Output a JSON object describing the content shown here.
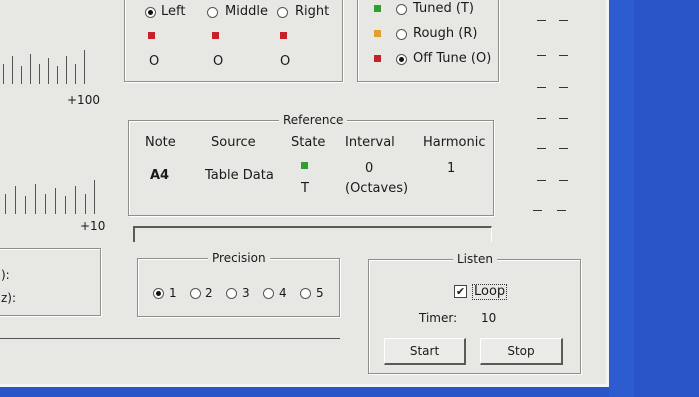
{
  "position_group": {
    "options": [
      {
        "label": "Left",
        "selected": true
      },
      {
        "label": "Middle",
        "selected": false
      },
      {
        "label": "Right",
        "selected": false
      }
    ],
    "values": [
      "O",
      "O",
      "O"
    ],
    "marker_color": "#c8202a"
  },
  "status_group": {
    "options": [
      {
        "label": "Tuned (T)",
        "color": "#2fa02f",
        "selected": false
      },
      {
        "label": "Rough (R)",
        "color": "#e0a030",
        "selected": false
      },
      {
        "label": "Off Tune (O)",
        "color": "#c8202a",
        "selected": true
      }
    ]
  },
  "scale_top": {
    "label": "+100"
  },
  "scale_bottom": {
    "label": "+10"
  },
  "reference": {
    "title": "Reference",
    "headers": {
      "note": "Note",
      "source": "Source",
      "state": "State",
      "interval": "Interval",
      "harmonic": "Harmonic"
    },
    "note": "A4",
    "source": "Table Data",
    "state_color": "#2fa02f",
    "state": "T",
    "interval": "0",
    "interval_unit": "(Octaves)",
    "harmonic": "1"
  },
  "left_panel": {
    "label_1": "):",
    "label_2": "z):"
  },
  "precision": {
    "title": "Precision",
    "options": [
      "1",
      "2",
      "3",
      "4",
      "5"
    ],
    "selected": "1"
  },
  "listen": {
    "title": "Listen",
    "loop_label": "Loop",
    "loop_checked": true,
    "check_mark": "✔",
    "timer_label": "Timer:",
    "timer_value": "10",
    "start_label": "Start",
    "stop_label": "Stop"
  },
  "colors": {
    "window_bg": "#e7e7e3",
    "desktop_bg": "#2a55c8"
  }
}
